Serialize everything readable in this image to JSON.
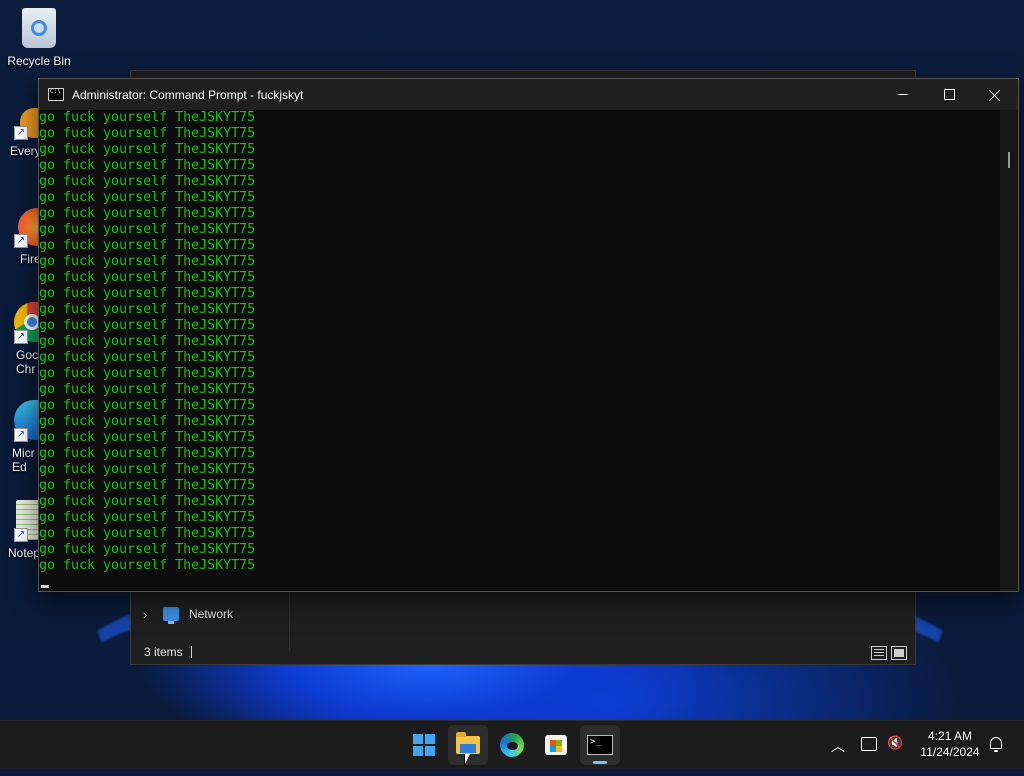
{
  "desktop": {
    "icons": [
      {
        "label": "Recycle Bin",
        "icon": "recycle-bin-icon"
      },
      {
        "label": "Every",
        "icon": "everything-icon"
      },
      {
        "label": "Fire",
        "icon": "firefox-icon"
      },
      {
        "label": "Goc\nChr",
        "icon": "google-chrome-icon"
      },
      {
        "label": "Micr\nEd",
        "icon": "microsoft-edge-icon"
      },
      {
        "label": "Notep",
        "icon": "notepad-icon"
      }
    ]
  },
  "explorer": {
    "nav_item": "Network",
    "status": "3 items"
  },
  "cmd": {
    "title": "Administrator: Command Prompt - fuckjskyt",
    "text_color": "#13C513",
    "lines": [
      "go fuck yourself TheJSKYT75",
      "go fuck yourself TheJSKYT75",
      "go fuck yourself TheJSKYT75",
      "go fuck yourself TheJSKYT75",
      "go fuck yourself TheJSKYT75",
      "go fuck yourself TheJSKYT75",
      "go fuck yourself TheJSKYT75",
      "go fuck yourself TheJSKYT75",
      "go fuck yourself TheJSKYT75",
      "go fuck yourself TheJSKYT75",
      "go fuck yourself TheJSKYT75",
      "go fuck yourself TheJSKYT75",
      "go fuck yourself TheJSKYT75",
      "go fuck yourself TheJSKYT75",
      "go fuck yourself TheJSKYT75",
      "go fuck yourself TheJSKYT75",
      "go fuck yourself TheJSKYT75",
      "go fuck yourself TheJSKYT75",
      "go fuck yourself TheJSKYT75",
      "go fuck yourself TheJSKYT75",
      "go fuck yourself TheJSKYT75",
      "go fuck yourself TheJSKYT75",
      "go fuck yourself TheJSKYT75",
      "go fuck yourself TheJSKYT75",
      "go fuck yourself TheJSKYT75",
      "go fuck yourself TheJSKYT75",
      "go fuck yourself TheJSKYT75",
      "go fuck yourself TheJSKYT75",
      "go fuck yourself TheJSKYT75"
    ]
  },
  "taskbar": {
    "apps": [
      "start-icon",
      "file-explorer-icon",
      "edge-icon",
      "microsoft-store-icon",
      "terminal-icon"
    ],
    "accent": "#6CC4FF",
    "time": "4:21 AM",
    "date": "11/24/2024"
  }
}
